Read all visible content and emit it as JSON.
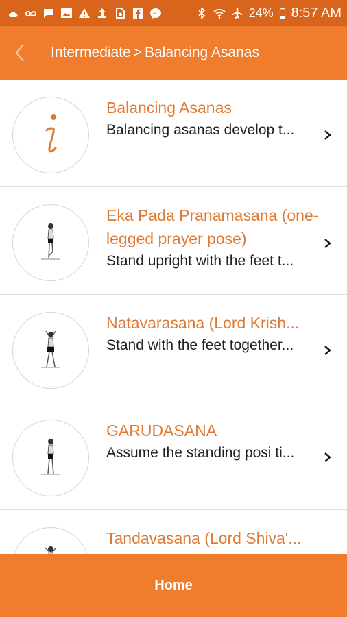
{
  "status_bar": {
    "battery_percent": "24%",
    "time": "8:57 AM",
    "icons": [
      "weather-icon",
      "voicemail-icon",
      "message-icon",
      "image-icon",
      "alert-icon",
      "upload-icon",
      "storage-icon",
      "facebook-icon",
      "messenger-icon",
      "bluetooth-icon",
      "wifi-icon",
      "airplane-icon",
      "battery-icon"
    ]
  },
  "app_bar": {
    "back_icon": "chevron-left-icon",
    "breadcrumb_parent": "Intermediate",
    "breadcrumb_separator": ">",
    "breadcrumb_current": "Balancing Asanas"
  },
  "items": [
    {
      "title": "Balancing Asanas",
      "description": "Balancing asanas develop t...",
      "thumb": "info-icon"
    },
    {
      "title": "Eka Pada Pranamasana (one-legged prayer pose)",
      "description": "Stand upright with the feet t...",
      "thumb": "pose-figure-icon"
    },
    {
      "title": "Natavarasana (Lord Krish...",
      "description": "Stand with the feet together...",
      "thumb": "pose-figure-icon"
    },
    {
      "title": "GARUDASANA",
      "description": "Assume the standing posi ti...",
      "thumb": "pose-figure-icon"
    },
    {
      "title": "Tandavasana (Lord Shiva'...",
      "description": "",
      "thumb": "pose-figure-icon"
    }
  ],
  "bottom_bar": {
    "home_label": "Home"
  },
  "colors": {
    "status_bar": "#d9651c",
    "primary": "#f07c2e",
    "title_text": "#e07a33"
  }
}
